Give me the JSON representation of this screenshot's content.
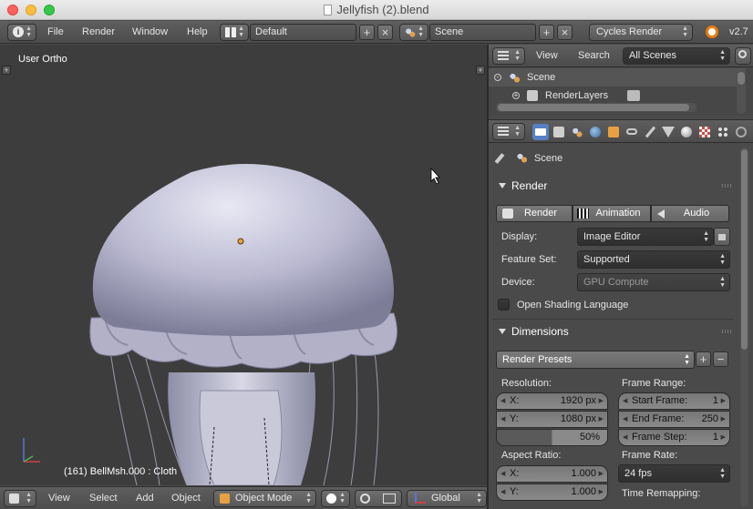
{
  "window": {
    "title": "Jellyfish (2).blend"
  },
  "info_header": {
    "menus": [
      "File",
      "Render",
      "Window",
      "Help"
    ],
    "screen_layout": "Default",
    "scene": "Scene",
    "render_engine": "Cycles Render",
    "version": "v2.7"
  },
  "viewport": {
    "view_name": "User Ortho",
    "status": "(161) BellMsh.000 : Cloth"
  },
  "view3d_header": {
    "menus": [
      "View",
      "Select",
      "Add",
      "Object"
    ],
    "mode": "Object Mode",
    "orientation": "Global"
  },
  "outliner": {
    "menus": [
      "View",
      "Search"
    ],
    "filter": "All Scenes",
    "items": [
      "Scene",
      "RenderLayers"
    ]
  },
  "properties": {
    "breadcrumb": "Scene",
    "render_panel": {
      "title": "Render",
      "buttons": [
        "Render",
        "Animation",
        "Audio"
      ],
      "display_label": "Display:",
      "display_value": "Image Editor",
      "feature_set_label": "Feature Set:",
      "feature_set_value": "Supported",
      "device_label": "Device:",
      "device_value": "GPU Compute",
      "osl_label": "Open Shading Language"
    },
    "dimensions_panel": {
      "title": "Dimensions",
      "presets": "Render Presets",
      "resolution_label": "Resolution:",
      "res_x_label": "X:",
      "res_x_value": "1920 px",
      "res_y_label": "Y:",
      "res_y_value": "1080 px",
      "res_percent": "50%",
      "aspect_label": "Aspect Ratio:",
      "aspect_x_label": "X:",
      "aspect_x_value": "1.000",
      "aspect_y_label": "Y:",
      "aspect_y_value": "1.000",
      "frame_range_label": "Frame Range:",
      "start_label": "Start Frame:",
      "start_value": "1",
      "end_label": "End Frame:",
      "end_value": "250",
      "step_label": "Frame Step:",
      "step_value": "1",
      "frame_rate_label": "Frame Rate:",
      "frame_rate_value": "24 fps",
      "time_remap_label": "Time Remapping:"
    }
  },
  "colors": {
    "viewport_bg": "#3d3d3d",
    "panel_bg": "#4a4a4a",
    "accent_blue": "#5680c2"
  }
}
